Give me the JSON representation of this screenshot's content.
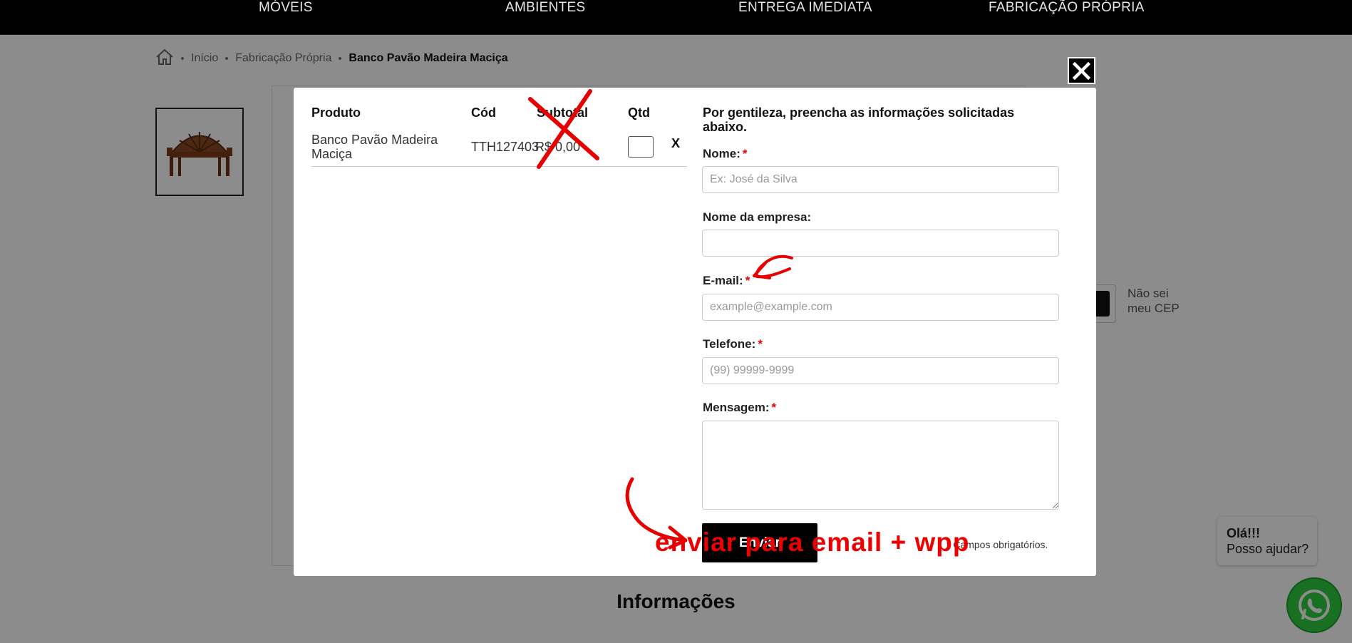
{
  "nav": {
    "items": [
      "MÓVEIS",
      "AMBIENTES",
      "ENTREGA IMEDIATA",
      "FABRICAÇÃO PRÓPRIA"
    ]
  },
  "breadcrumb": {
    "home_icon": "home-icon",
    "items": [
      "Início",
      "Fabricação Própria"
    ],
    "current": "Banco Pavão Madeira Maciça"
  },
  "page": {
    "cep_help": "Não sei meu CEP",
    "info_title": "Informações"
  },
  "chat": {
    "greeting": "Olá!!!",
    "message": "Posso ajudar?",
    "icon": "whatsapp-icon"
  },
  "modal": {
    "close_icon": "close-icon",
    "table": {
      "headers": [
        "Produto",
        "Cód",
        "Subtotal",
        "Qtd"
      ],
      "rows": [
        {
          "produto": "Banco Pavão Madeira Maciça",
          "cod": "TTH127403",
          "subtotal": "R$ 0,00",
          "qtd": "",
          "remove": "X"
        }
      ]
    },
    "form": {
      "intro": "Por gentileza, preencha as informações solicitadas abaixo.",
      "fields": {
        "nome": {
          "label": "Nome:",
          "required": "*",
          "placeholder": "Ex: José da Silva",
          "value": ""
        },
        "empresa": {
          "label": "Nome da empresa:",
          "placeholder": "",
          "value": ""
        },
        "email": {
          "label": "E-mail:",
          "required": "*",
          "placeholder": "example@example.com",
          "value": ""
        },
        "telefone": {
          "label": "Telefone:",
          "required": "*",
          "placeholder": "(99) 99999-9999",
          "value": ""
        },
        "mensagem": {
          "label": "Mensagem:",
          "required": "*",
          "placeholder": "",
          "value": ""
        }
      },
      "submit_label": "Enviar",
      "required_note": "* Campos obrigatórios."
    }
  },
  "annotation": {
    "text": "enviar para email + wpp",
    "color": "#e60000"
  },
  "colors": {
    "nav_bg": "#000000",
    "accent_red": "#e60000",
    "whatsapp": "#2ecc40"
  }
}
